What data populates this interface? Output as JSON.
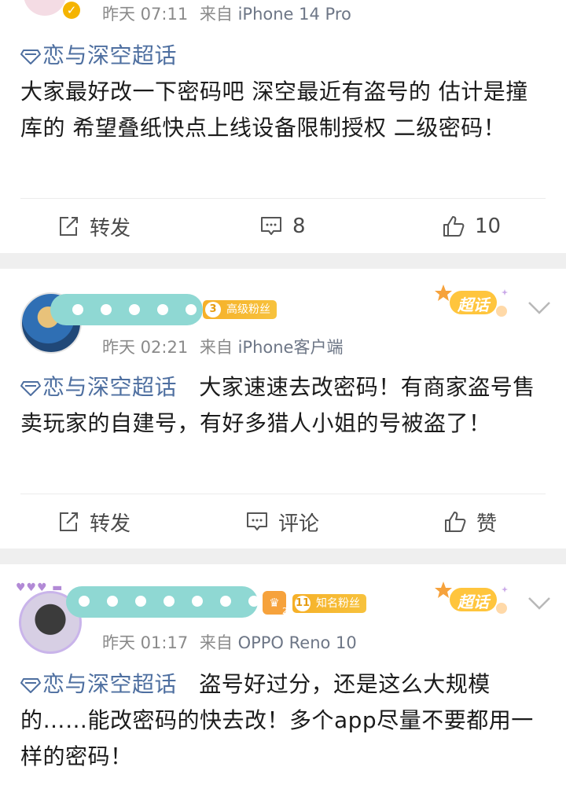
{
  "posts": [
    {
      "time": "昨天 07:11",
      "source_prefix": "来自",
      "source": "iPhone 14 Pro",
      "topic": "恋与深空超话",
      "text": "大家最好改一下密码吧 深空最近有盗号的 估计是撞库的 希望叠纸快点上线设备限制授权 二级密码！",
      "repost_label": "转发",
      "comment_count": "8",
      "like_count": "10"
    },
    {
      "time": "昨天 02:21",
      "source_prefix": "来自",
      "source": "iPhone客户端",
      "badge_level": "3",
      "badge_label": "高级粉丝",
      "chaohua_label": "超话",
      "topic": "恋与深空超话",
      "text": "大家速速去改密码！有商家盗号售卖玩家的自建号，有好多猎人小姐的号被盗了！",
      "repost_label": "转发",
      "comment_label": "评论",
      "like_label": "赞"
    },
    {
      "time": "昨天 01:17",
      "source_prefix": "来自",
      "source": "OPPO Reno 10",
      "crown_level": "2",
      "badge_level": "11",
      "badge_label": "知名粉丝",
      "chaohua_label": "超话",
      "topic": "恋与深空超话",
      "text": "盗号好过分，还是这么大规模的……能改密码的快去改！多个app尽量不要都用一样的密码！"
    }
  ],
  "colors": {
    "topic": "#4e6fa0",
    "badge": "#f6b028",
    "censor": "#8fd8d3",
    "divider_bg": "#efefef"
  }
}
